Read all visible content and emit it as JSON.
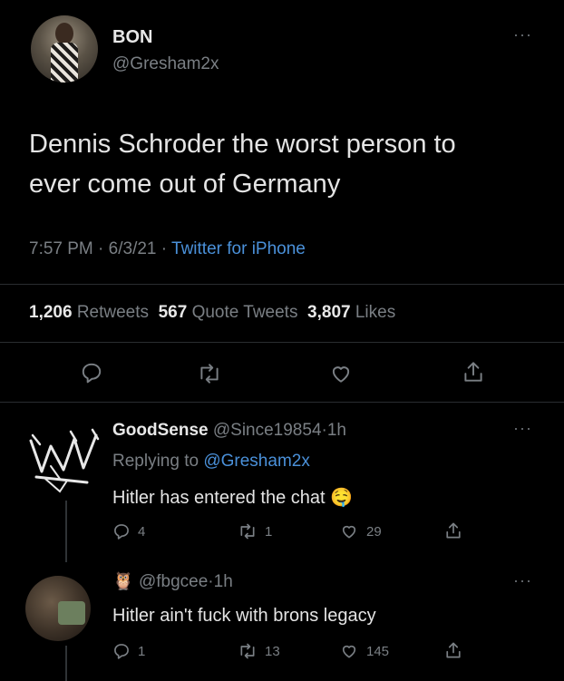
{
  "main_tweet": {
    "display_name": "BON",
    "handle": "@Gresham2x",
    "text_line1": "Dennis Schroder the worst person to",
    "text_line2": "ever come out of Germany",
    "time": "7:57 PM",
    "sep1": "·",
    "date": "6/3/21",
    "sep2": "·",
    "source": "Twitter for iPhone",
    "retweets_count": "1,206",
    "retweets_label": "Retweets",
    "quotes_count": "567",
    "quotes_label": "Quote Tweets",
    "likes_count": "3,807",
    "likes_label": "Likes",
    "more": "···"
  },
  "reply1": {
    "display_name": "GoodSense",
    "handle": "@Since19854",
    "sep": "·",
    "age": "1h",
    "replying_prefix": "Replying to",
    "replying_handle": "@Gresham2x",
    "text": "Hitler has entered the chat",
    "emoji": "🤤",
    "reply_count": "4",
    "retweet_count": "1",
    "like_count": "29",
    "more": "···"
  },
  "reply2": {
    "name_emoji": "🦉",
    "handle": "@fbgcee",
    "sep": "·",
    "age": "1h",
    "text": "Hitler ain't fuck with brons legacy",
    "reply_count": "1",
    "retweet_count": "13",
    "like_count": "145",
    "more": "···"
  },
  "icons": {
    "reply": "speech-bubble-icon",
    "retweet": "retweet-arrows-icon",
    "like": "heart-icon",
    "share": "share-upload-icon"
  }
}
